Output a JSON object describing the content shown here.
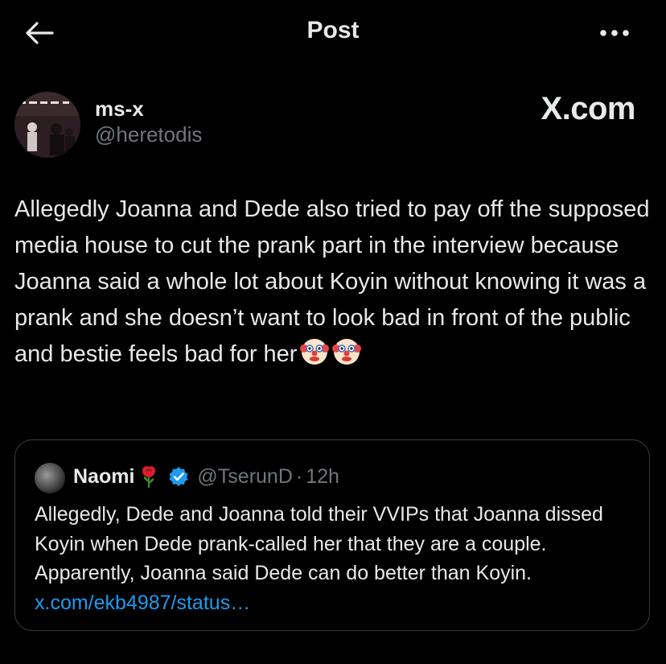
{
  "header": {
    "title": "Post"
  },
  "author": {
    "name": "ms-x",
    "handle": "@heretodis"
  },
  "brand": "X.com",
  "tweet": {
    "text": "Allegedly Joanna and Dede also tried to pay off the supposed media house to cut the prank part in the interview because Joanna said a whole lot about Koyin without knowing it was a prank and she doesn’t want to look bad in front of the public and bestie feels bad for her",
    "emojis": [
      "clown-face-emoji",
      "clown-face-emoji"
    ]
  },
  "quoted": {
    "name": "Naomi",
    "name_emoji": "rose-emoji",
    "verified": true,
    "handle": "@TserunD",
    "separator": "·",
    "time": "12h",
    "text": "Allegedly, Dede and Joanna told their VVIPs that Joanna dissed Koyin when  Dede prank-called her that they are a couple. Apparently, Joanna said Dede can do better than Koyin. ",
    "link": "x.com/ekb4987/status…"
  },
  "colors": {
    "background": "#000000",
    "text": "#e7e9ea",
    "secondary": "#71767b",
    "link": "#1d9bf0",
    "border": "#3a3d41",
    "verified": "#1d9bf0"
  },
  "icons": [
    "back-arrow-icon",
    "more-options-icon",
    "verified-badge-icon"
  ]
}
